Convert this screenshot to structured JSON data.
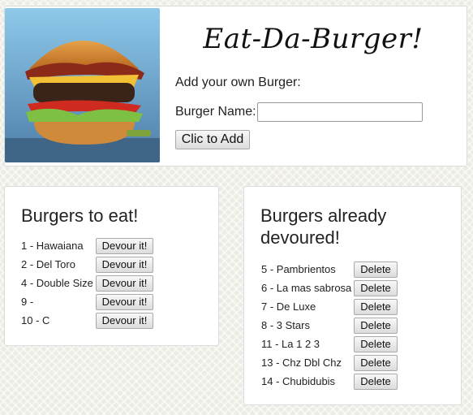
{
  "header": {
    "title": "Eat-Da-Burger!",
    "add_label": "Add your own Burger:",
    "name_label": "Burger Name:",
    "name_input_value": "",
    "name_input_placeholder": "",
    "add_button_label": "Clic to Add"
  },
  "to_eat": {
    "title": "Burgers to eat!",
    "button_label": "Devour it!",
    "items": [
      {
        "label": "1 - Hawaiana"
      },
      {
        "label": "2 - Del Toro"
      },
      {
        "label": "4 - Double Size"
      },
      {
        "label": "9 -"
      },
      {
        "label": "10 - C"
      }
    ]
  },
  "devoured": {
    "title": "Burgers already devoured!",
    "button_label": "Delete",
    "items": [
      {
        "label": "5 - Pambrientos"
      },
      {
        "label": "6 - La mas sabrosa"
      },
      {
        "label": "7 - De Luxe"
      },
      {
        "label": "8 - 3 Stars"
      },
      {
        "label": "11 - La 1 2 3"
      },
      {
        "label": "13 - Chz Dbl Chz"
      },
      {
        "label": "14 - Chubidubis"
      }
    ]
  },
  "colors": {
    "page_background": "#ecebe4",
    "card_background": "#ffffff",
    "button_background": "#e6e6e6"
  }
}
